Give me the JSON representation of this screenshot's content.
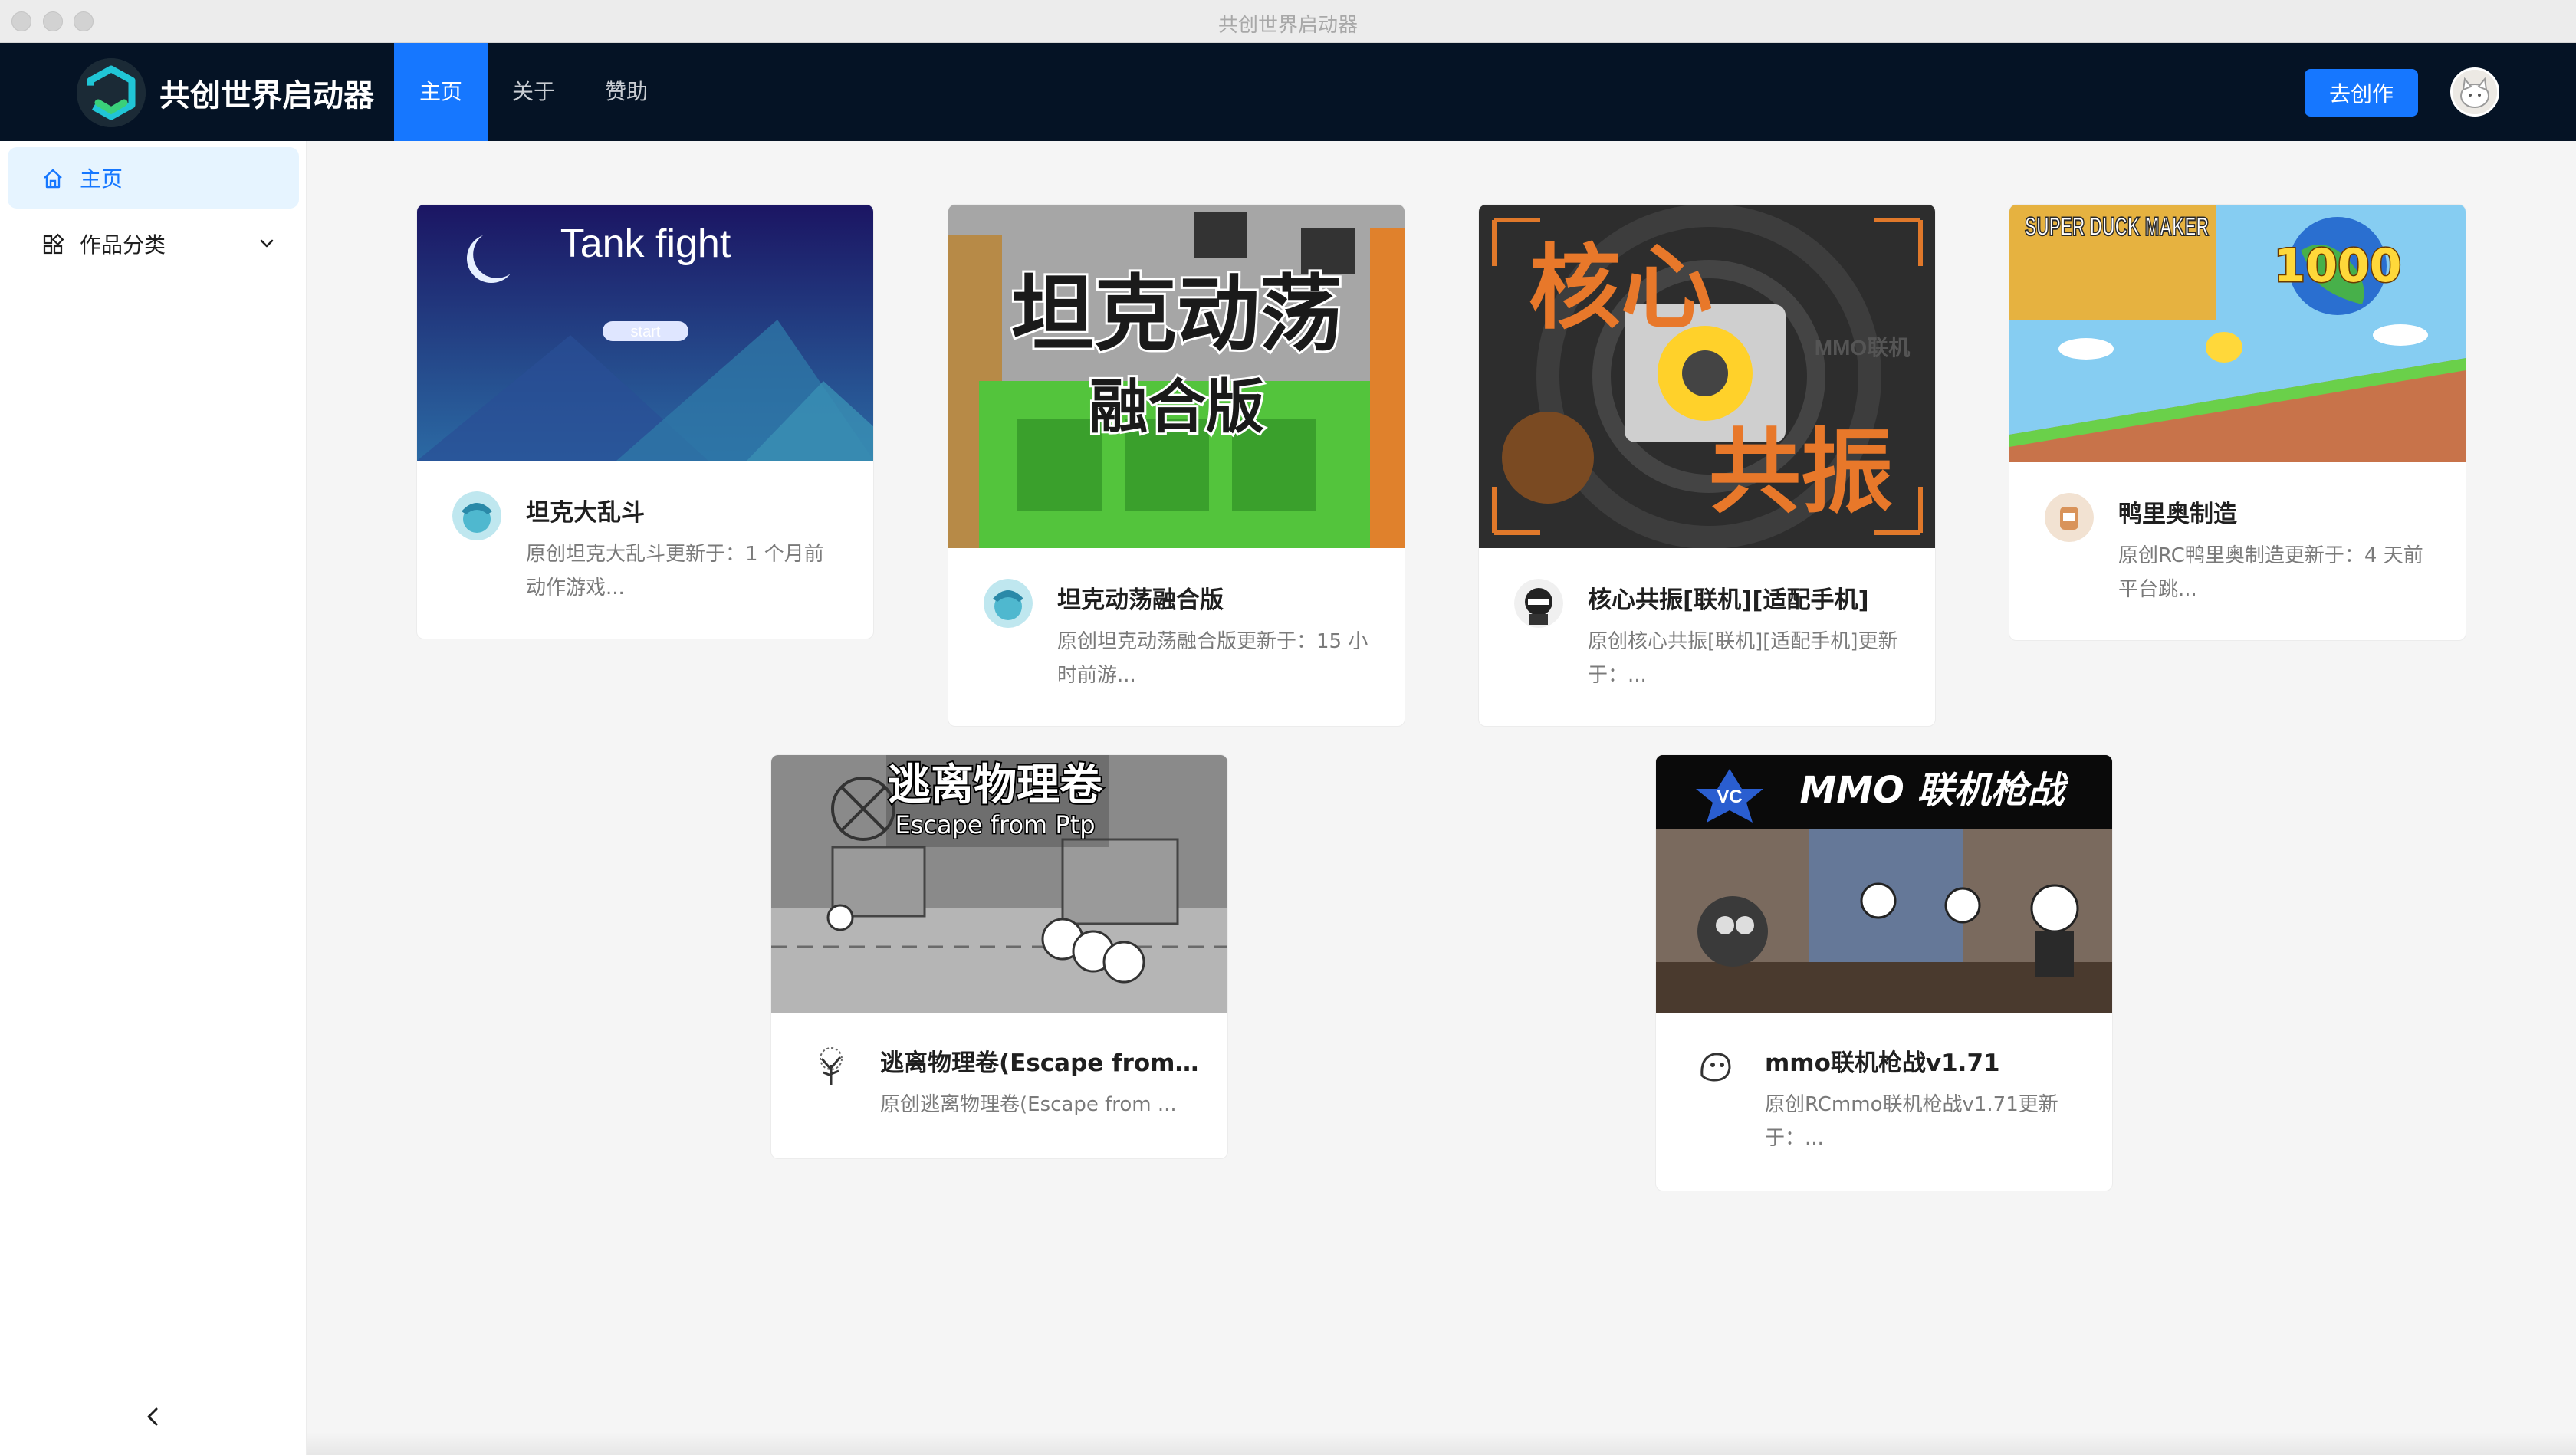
{
  "window": {
    "title": "共创世界启动器"
  },
  "header": {
    "brand": "共创世界启动器",
    "nav": [
      {
        "label": "主页",
        "active": true
      },
      {
        "label": "关于",
        "active": false
      },
      {
        "label": "赞助",
        "active": false
      }
    ],
    "create_button": "去创作",
    "accent_color": "#1677ff",
    "background_color": "#051325"
  },
  "sidebar": {
    "items": [
      {
        "label": "主页",
        "icon": "home-icon",
        "active": true
      },
      {
        "label": "作品分类",
        "icon": "apps-icon",
        "expandable": true
      }
    ],
    "collapse_icon": "chevron-left-icon"
  },
  "works": [
    {
      "cover_text": "Tank fight",
      "cover_button": "start",
      "title": "坦克大乱斗",
      "desc": "原创坦克大乱斗更新于：1 个月前动作游戏..."
    },
    {
      "cover_text": "坦克动荡",
      "cover_subtext": "融合版",
      "title": "坦克动荡融合版",
      "desc": "原创坦克动荡融合版更新于：15 小时前游..."
    },
    {
      "cover_text": "核心",
      "cover_subtext": "共振",
      "cover_tag": "MMO联机",
      "title": "核心共振[联机][适配手机]",
      "desc": "原创核心共振[联机][适配手机]更新于：..."
    },
    {
      "cover_text": "SUPER DUCK MAKER",
      "cover_badge": "1000",
      "title": "鸭里奥制造",
      "desc": "原创RC鸭里奥制造更新于：4 天前平台跳..."
    },
    {
      "cover_text": "逃离物理卷",
      "cover_subtext": "Escape from Ptp",
      "title": "逃离物理卷(Escape from ...",
      "desc": "原创逃离物理卷(Escape from ..."
    },
    {
      "cover_text": "MMO 联机枪战",
      "cover_badge": "VC",
      "title": "mmo联机枪战v1.71",
      "desc": "原创RCmmo联机枪战v1.71更新于：..."
    }
  ]
}
